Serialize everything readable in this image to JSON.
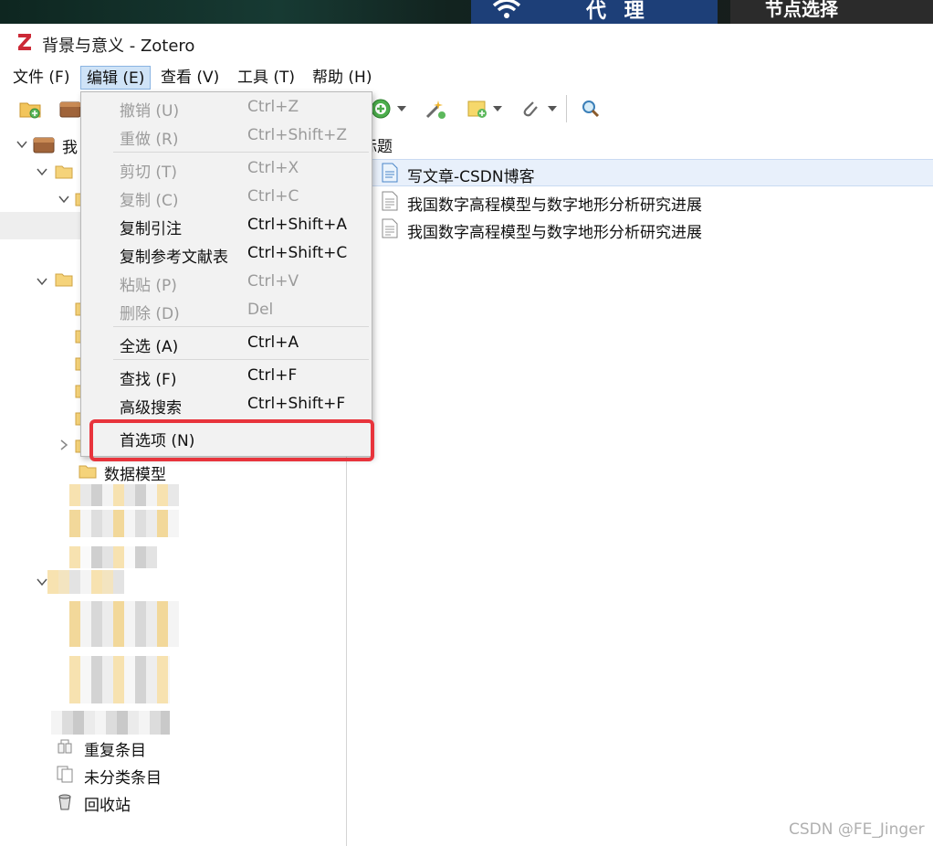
{
  "desktop": {
    "proxy_label": "代 理",
    "node_label": "节点选择"
  },
  "window": {
    "title": "背景与意义 - Zotero"
  },
  "menubar": {
    "items": [
      {
        "label": "文件 (F)"
      },
      {
        "label": "编辑 (E)"
      },
      {
        "label": "查看 (V)"
      },
      {
        "label": "工具 (T)"
      },
      {
        "label": "帮助 (H)"
      }
    ]
  },
  "edit_menu": {
    "items": [
      {
        "label": "撤销 (U)",
        "shortcut": "Ctrl+Z",
        "enabled": false
      },
      {
        "label": "重做 (R)",
        "shortcut": "Ctrl+Shift+Z",
        "enabled": false
      },
      {
        "label": "剪切 (T)",
        "shortcut": "Ctrl+X",
        "enabled": false
      },
      {
        "label": "复制 (C)",
        "shortcut": "Ctrl+C",
        "enabled": false
      },
      {
        "label": "复制引注",
        "shortcut": "Ctrl+Shift+A",
        "enabled": true
      },
      {
        "label": "复制参考文献表",
        "shortcut": "Ctrl+Shift+C",
        "enabled": true
      },
      {
        "label": "粘贴 (P)",
        "shortcut": "Ctrl+V",
        "enabled": false
      },
      {
        "label": "删除 (D)",
        "shortcut": "Del",
        "enabled": false
      },
      {
        "label": "全选 (A)",
        "shortcut": "Ctrl+A",
        "enabled": true
      },
      {
        "label": "查找 (F)",
        "shortcut": "Ctrl+F",
        "enabled": true
      },
      {
        "label": "高级搜索",
        "shortcut": "Ctrl+Shift+F",
        "enabled": true
      },
      {
        "label": "首选项 (N)",
        "shortcut": "",
        "enabled": true
      }
    ],
    "highlight_color": "#e8343c"
  },
  "collections": {
    "library_label_partial": "我",
    "visible_folder_label": "数据模型",
    "special_items": [
      {
        "label": "重复条目",
        "icon": "duplicate-items-icon"
      },
      {
        "label": "未分类条目",
        "icon": "unfiled-items-icon"
      },
      {
        "label": "回收站",
        "icon": "trash-icon"
      }
    ]
  },
  "items": {
    "column_header": "标题",
    "rows": [
      {
        "title": "写文章-CSDN博客",
        "icon": "webpage-icon",
        "selected": true
      },
      {
        "title": "我国数字高程模型与数字地形分析研究进展",
        "icon": "document-icon",
        "selected": false
      },
      {
        "title": "我国数字高程模型与数字地形分析研究进展",
        "icon": "document-icon",
        "selected": false
      }
    ]
  },
  "watermark": "CSDN @FE_Jinger",
  "colors": {
    "proxy_panel": "#1d3f78",
    "menu_active": "#cfe3f7",
    "selected_row": "#e8f0fb"
  }
}
